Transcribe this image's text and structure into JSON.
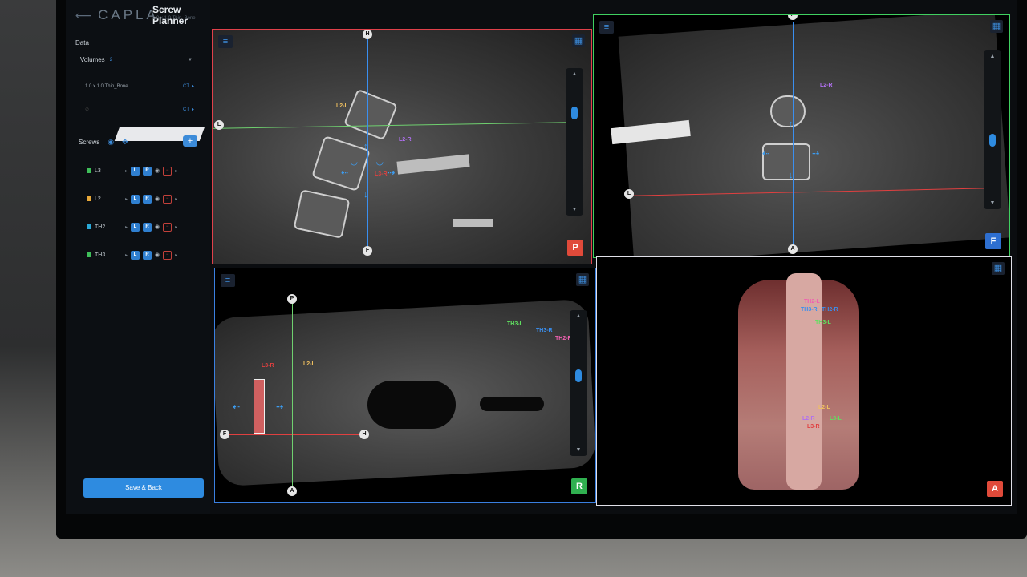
{
  "app": {
    "logo_text": "CAPLA",
    "title": "Screw Planner",
    "subtitle": "1.0 x 1.0 Thin_Bone"
  },
  "sidebar": {
    "data_label": "Data",
    "volumes_label": "Volumes",
    "volumes_count": "2",
    "volumes": [
      {
        "name": "1.0 x 1.0 Thin_Bone",
        "type": "CT"
      },
      {
        "name": "",
        "type": "CT"
      }
    ],
    "screws_label": "Screws",
    "screws": [
      {
        "name": "L3",
        "color": "#3fbf5a",
        "left": "L",
        "right": "R"
      },
      {
        "name": "L2",
        "color": "#e8a93a",
        "left": "L",
        "right": "R"
      },
      {
        "name": "TH2",
        "color": "#2aa9d8",
        "left": "L",
        "right": "R"
      },
      {
        "name": "TH3",
        "color": "#3fbf5a",
        "left": "L",
        "right": "R"
      }
    ],
    "save_label": "Save & Back"
  },
  "viewports": {
    "sagittal": {
      "orientation": "P",
      "orientation_color": "#e04a3a",
      "border_color": "#e0404a",
      "axis_labels": {
        "top": "H",
        "bottom": "F",
        "left": "L"
      },
      "screw_labels": [
        {
          "text": "L2-L",
          "color": "#f0c060"
        },
        {
          "text": "L2-R",
          "color": "#b070f0"
        },
        {
          "text": "L3-R",
          "color": "#e04040"
        }
      ]
    },
    "axial": {
      "orientation": "F",
      "orientation_color": "#2e6fd0",
      "border_color": "#40d060",
      "axis_labels": {
        "top": "P",
        "bottom": "A",
        "left": "L"
      },
      "screw_labels": [
        {
          "text": "L2-R",
          "color": "#b070f0"
        }
      ]
    },
    "coronal": {
      "orientation": "R",
      "orientation_color": "#30b050",
      "border_color": "#3a7fe0",
      "axis_labels": {
        "top": "P",
        "bottom": "A",
        "left": "F",
        "right": "H"
      },
      "screw_labels": [
        {
          "text": "L3-R",
          "color": "#e04040"
        },
        {
          "text": "L2-L",
          "color": "#f0c060"
        },
        {
          "text": "TH3-L",
          "color": "#60e060"
        },
        {
          "text": "TH3-R",
          "color": "#3a8ff0"
        },
        {
          "text": "TH2-R",
          "color": "#f060b0"
        }
      ]
    },
    "volume3d": {
      "orientation": "A",
      "orientation_color": "#e04a3a",
      "border_color": "#e0e0e8",
      "screw_labels": [
        {
          "text": "TH2-L",
          "color": "#f060b0"
        },
        {
          "text": "TH3-R",
          "color": "#3a8ff0"
        },
        {
          "text": "TH2-R",
          "color": "#3a8ff0"
        },
        {
          "text": "TH3-L",
          "color": "#60e060"
        },
        {
          "text": "L2-L",
          "color": "#f0c060"
        },
        {
          "text": "L3-L",
          "color": "#60e060"
        },
        {
          "text": "L2-R",
          "color": "#b070f0"
        },
        {
          "text": "L3-R",
          "color": "#e04040"
        }
      ]
    }
  }
}
